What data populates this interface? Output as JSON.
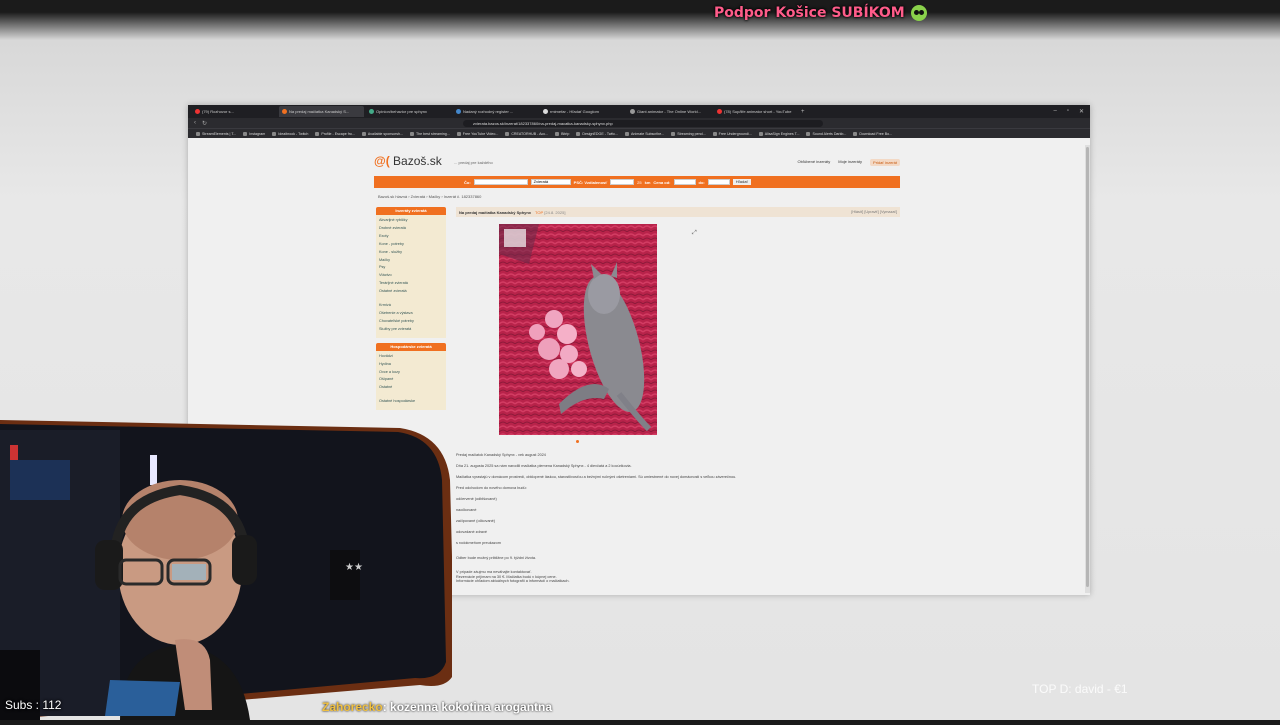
{
  "overlay": {
    "title": "Podpor Košice SUBÍKOM",
    "subs": "Subs : 112",
    "top_donor": "TOP D: david - €1",
    "chat": {
      "user": "Zahorecko",
      "message": ": kozenna kokotina arogantna"
    }
  },
  "browser": {
    "tabs": [
      {
        "label": "(79) Rozhovor s...",
        "active": false
      },
      {
        "label": "Na predaj mačiatka Kanadský S...",
        "active": true
      },
      {
        "label": "Opinion/behavior pre sphynx",
        "active": false
      },
      {
        "label": "Nadaný rozhodný register ...",
        "active": false
      },
      {
        "label": "rmimefar - Hľadať Googlom",
        "active": false
      },
      {
        "label": "Giant animator - The Online World...",
        "active": false
      },
      {
        "label": "(78) Sup/life animator short - YouTube",
        "active": false
      }
    ],
    "url": "zvierata.bazos.sk/inzerat/182337860/na-predaj-macatka-kanadsky-sphynx.php",
    "bookmarks": [
      "StreamElements | T...",
      "Instagram",
      "Ideaibrook - Twitch",
      "Profile - Escape fro...",
      "Available sponsorsh...",
      "The best streaming...",
      "Free YouTube Video...",
      "CREATORHUB - Acc...",
      "Bitrip",
      "DesignEDGE - Twitc...",
      "Animate Subscribe...",
      "Streaming pend...",
      "Free Undergroundi...",
      "AlisaSign Engines T...",
      "Sound Alerts Darkb...",
      "Download Free Bo..."
    ]
  },
  "site": {
    "logo_at": "@(",
    "logo": "Bazoš.sk",
    "tagline": "... predaj pre každého",
    "header_links": [
      "Obľúbené inzeráty",
      "Moje inzeráty",
      "Pridať inzerát"
    ],
    "search": {
      "what_label": "Čo:",
      "category": "Zvieratá",
      "psc_label": "PSČ: Vzdialenosť",
      "km": "25",
      "unit": "km",
      "price_from_label": "Cena od:",
      "price_to_label": "do:",
      "button": "Hľadať"
    },
    "breadcrumb": "Bazoš.sk hlavná › Zvieratá › Mačky › Inzerát č. 182337860",
    "sidebar": {
      "heading1": "Inzeráty zvieratá",
      "group1": [
        "Akvarijné rybičky",
        "Drobné zvieratá",
        "Exoty",
        "Kone - potreby",
        "Kone - služby",
        "Mačky",
        "Psy",
        "Vtáctvo",
        "Terárijné zvieratá",
        "Ostatné zvieratá"
      ],
      "group2": [
        "Krmivá",
        "Ošetrenie a výstava",
        "Chovateľské potreby",
        "Služby pre zvieratá"
      ],
      "heading2": "Hospodárske zvieratá",
      "group3": [
        "Hovädzí",
        "Hydina",
        "Ovce a kozy",
        "Ošípané",
        "Ostatné"
      ],
      "footer": "Ostatné hospodárske"
    },
    "ad": {
      "title": "Na predaj mačiatka Kanadský Sphynx",
      "top": "TOP",
      "date": "[24.8. 2025]",
      "actions": "[Hlásiť] [Upraviť] [Vymazať]",
      "description": [
        "Predaj mačiatok Kanadský Sphynx - vek august 2024",
        "Dňa 21. augusta 2025 sa nám narodili mačiatka plemena Kanadský Sphynx - 4 dievčatá a 2 kocúrikovia.",
        "Mačiatka vyrastajú v domácom prostredí, obklopené láskou, starostlivosťou a bežnými ručnými ošetreniami. Sú umiestnené do novej domácnosti s veľkou záverečnou.",
        "Pred odchodom do nového domova budú:",
        "odčervené (odblšované)",
        "naočkované",
        "začipované (očkované)",
        "odovzdané zdravé",
        "s rodokmeňom preukazom"
      ],
      "contact": [
        "Odber bude možný približne po 9. týždni života.",
        "V prípade záujmu ma neváhajte kontaktovať.",
        "Rezervácie prijímam na 30 €. Mačiatka budú v kúpnej cene.",
        "Informácie ohľadom aktuálnych fotografií a informácii o mačiatkach."
      ]
    }
  },
  "colors": {
    "accent": "#f07020",
    "sidebar_bg": "#f3ead2",
    "overlay_title": "#ff5c8a"
  }
}
